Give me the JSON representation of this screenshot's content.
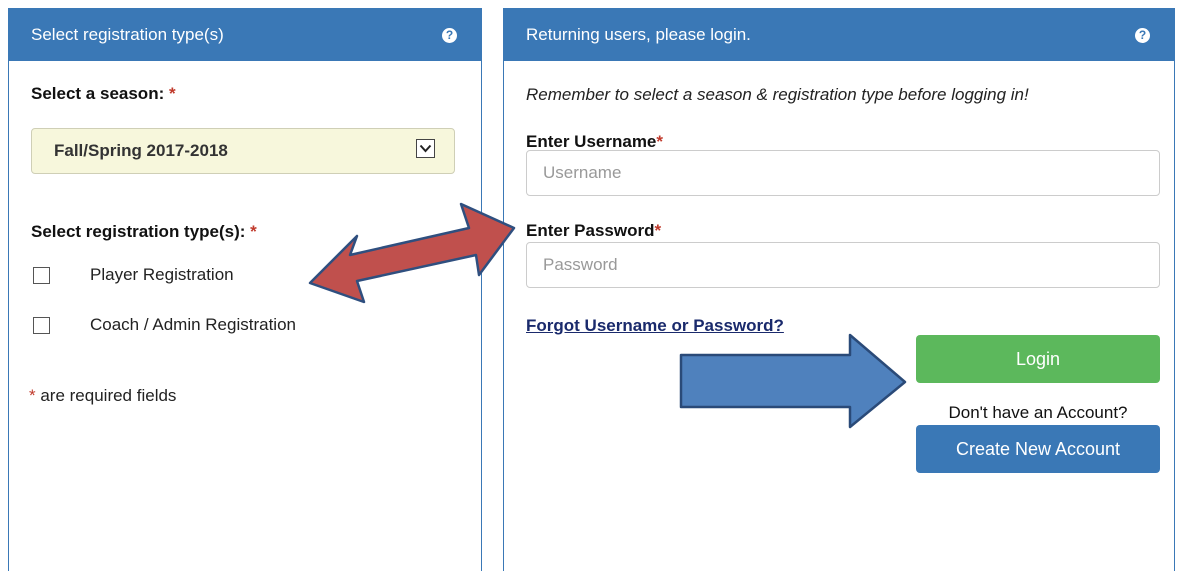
{
  "left_panel": {
    "header_title": "Select registration type(s)",
    "season_label": "Select a season: ",
    "season_selected": "Fall/Spring 2017-2018",
    "type_label": "Select registration type(s): ",
    "options": [
      {
        "label": "Player Registration",
        "checked": false
      },
      {
        "label": "Coach / Admin Registration",
        "checked": false
      }
    ],
    "required_note": " are required fields"
  },
  "right_panel": {
    "header_title": "Returning users, please login.",
    "reminder": "Remember to select a season & registration type before logging in!",
    "username_label": "Enter Username",
    "username_placeholder": "Username",
    "password_label": "Enter Password",
    "password_placeholder": "Password",
    "forgot_link": "Forgot Username or Password?",
    "login_button": "Login",
    "no_account_text": "Don't have an Account?",
    "create_button": "Create New Account"
  },
  "common": {
    "required_marker": "*",
    "help_icon_glyph": "?"
  },
  "colors": {
    "header_blue": "#3a78b6",
    "login_green": "#5cb85c",
    "required_red": "#c0392b",
    "arrow_red": "#c0504d",
    "arrow_blue": "#4f81bd",
    "select_bg": "#f7f7dc"
  },
  "icons": {
    "help": "question-circle-icon",
    "dropdown": "chevron-down-icon",
    "annotation_double": "double-arrow-icon",
    "annotation_right": "right-arrow-icon"
  }
}
